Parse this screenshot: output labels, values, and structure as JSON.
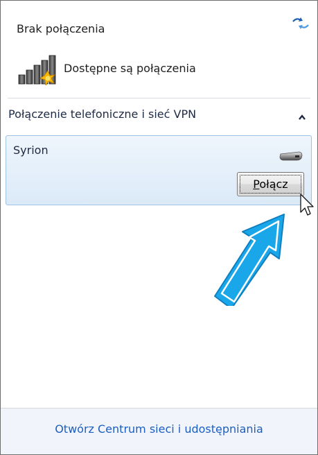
{
  "status": {
    "title": "Brak połączenia",
    "available_label": "Dostępne są połączenia"
  },
  "section": {
    "title": "Połączenie telefoniczne i sieć VPN"
  },
  "connection": {
    "name": "Syrion",
    "connect_label_underlined": "P",
    "connect_label_rest": "ołącz"
  },
  "footer": {
    "link": "Otwórz Centrum sieci i udostępniania"
  },
  "icons": {
    "refresh": "network-refresh-icon",
    "signal": "signal-bars-warning-icon",
    "chevron": "chevron-up-icon",
    "modem": "dialup-modem-icon",
    "cursor": "mouse-pointer-icon",
    "arrow": "highlight-arrow-icon"
  },
  "colors": {
    "accent_link": "#1c5ebf",
    "selection_bg": "#dbeaf8",
    "selection_border": "#9fc1e2",
    "highlight_arrow": "#1aa7ea"
  }
}
